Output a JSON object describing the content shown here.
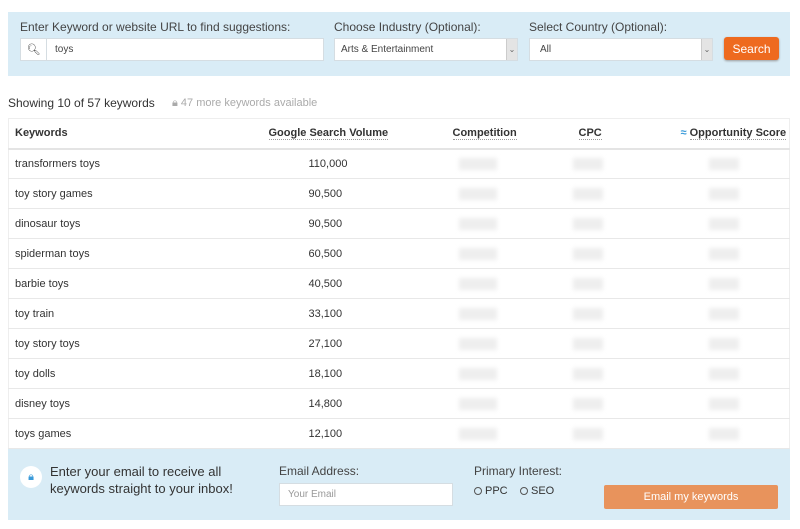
{
  "search": {
    "keyword_label": "Enter Keyword or website URL to find suggestions:",
    "keyword_value": "toys",
    "industry_label": "Choose Industry (Optional):",
    "industry_value": "Arts & Entertainment",
    "country_label": "Select Country (Optional):",
    "country_value": "All",
    "button": "Search"
  },
  "summary": {
    "showing": "Showing 10 of 57 keywords",
    "more": "47 more keywords available"
  },
  "table": {
    "headers": [
      "Keywords",
      "Google Search Volume",
      "Competition",
      "CPC",
      "Opportunity Score"
    ],
    "rows": [
      [
        "transformers toys",
        "110,000"
      ],
      [
        "toy story games",
        "90,500"
      ],
      [
        "dinosaur toys",
        "90,500"
      ],
      [
        "spiderman toys",
        "60,500"
      ],
      [
        "barbie toys",
        "40,500"
      ],
      [
        "toy train",
        "33,100"
      ],
      [
        "toy story toys",
        "27,100"
      ],
      [
        "toy dolls",
        "18,100"
      ],
      [
        "disney toys",
        "14,800"
      ],
      [
        "toys games",
        "12,100"
      ]
    ]
  },
  "email": {
    "promo": "Enter your email to receive all keywords straight to your inbox!",
    "address_label": "Email Address:",
    "placeholder": "Your Email",
    "interest_label": "Primary Interest:",
    "options": [
      "PPC",
      "SEO"
    ],
    "button": "Email my keywords"
  },
  "colors": {
    "accent": "#ee6a1f",
    "panel": "#d9ecf6"
  }
}
